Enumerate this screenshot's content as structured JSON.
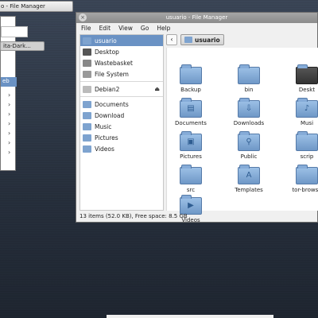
{
  "taskbar": {
    "window_label": "o - File Manager"
  },
  "left_menu": {
    "theme_label": "ita-Dark...",
    "highlight_label": "eb",
    "chevron": "›"
  },
  "window": {
    "title": "usuario - File Manager",
    "menu": [
      "File",
      "Edit",
      "View",
      "Go",
      "Help"
    ]
  },
  "sidebar": {
    "places": [
      {
        "label": "usuario",
        "icon": "home-folder-icon",
        "active": true
      },
      {
        "label": "Desktop",
        "icon": "desktop-icon"
      },
      {
        "label": "Wastebasket",
        "icon": "trash-icon"
      },
      {
        "label": "File System",
        "icon": "drive-icon"
      }
    ],
    "devices": [
      {
        "label": "Debian2",
        "icon": "disk-icon",
        "eject": "⏏"
      }
    ],
    "bookmarks": [
      {
        "label": "Documents"
      },
      {
        "label": "Download"
      },
      {
        "label": "Music"
      },
      {
        "label": "Pictures"
      },
      {
        "label": "Videos"
      }
    ]
  },
  "path": {
    "back": "‹",
    "current": "usuario"
  },
  "items": [
    {
      "label": "Backup",
      "glyph": ""
    },
    {
      "label": "bin",
      "glyph": ""
    },
    {
      "label": "Deskt",
      "glyph": "",
      "desk": true
    },
    {
      "label": "Documents",
      "glyph": "▤"
    },
    {
      "label": "Downloads",
      "glyph": "⇩"
    },
    {
      "label": "Musi",
      "glyph": "♪"
    },
    {
      "label": "Pictures",
      "glyph": "▣"
    },
    {
      "label": "Public",
      "glyph": "⚲"
    },
    {
      "label": "scrip",
      "glyph": ""
    },
    {
      "label": "src",
      "glyph": ""
    },
    {
      "label": "Templates",
      "glyph": "A"
    },
    {
      "label": "tor-browse",
      "glyph": ""
    },
    {
      "label": "Videos",
      "glyph": "▶"
    }
  ],
  "status": "13 items (52.0 KB), Free space: 8.5 GB",
  "colors": {
    "accent": "#6a92c4",
    "folder": "#86acd8"
  }
}
